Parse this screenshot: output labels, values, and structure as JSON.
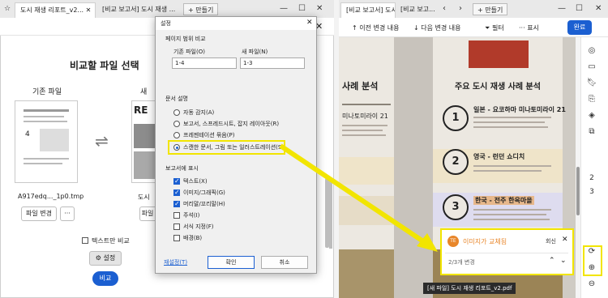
{
  "left_window": {
    "tabs": [
      "도시 재생 리포트_v2...",
      "[비교 보고서] 도시 재생 ..."
    ],
    "new_tab_label": "만들기",
    "heading": "비교할 파일 선택",
    "original_label": "기존 파일",
    "original_filename": "A917edq..._1p0.tmp",
    "change_file_label": "파일 변경",
    "more_label": "···",
    "new_label_partial": "새",
    "new_filename_partial": "도시",
    "new_change_partial": "파일",
    "text_only_label": "텍스트만 비교",
    "settings_label": "설정",
    "compare_label": "비교"
  },
  "dialog": {
    "title": "설정",
    "page_range_title": "페이지 범위 비교",
    "original_file_label": "기존 파일(O)",
    "original_range": "1-4",
    "new_file_label": "새 파일(N)",
    "new_range": "1-3",
    "doc_desc_title": "문서 설명",
    "radios": [
      {
        "label": "자동 감지(A)",
        "selected": false
      },
      {
        "label": "보고서, 스프레드시트, 잡지 레이아웃(R)",
        "selected": false
      },
      {
        "label": "프레젠테이션 묶음(P)",
        "selected": false
      },
      {
        "label": "스캔한 문서, 그림 또는 일러스트레이션(S)",
        "selected": true
      }
    ],
    "show_title": "보고서에 표시",
    "checks": [
      {
        "label": "텍스트(X)",
        "checked": true
      },
      {
        "label": "이미지/그래픽(G)",
        "checked": true
      },
      {
        "label": "머리말/꼬리말(H)",
        "checked": true
      },
      {
        "label": "주석(I)",
        "checked": false
      },
      {
        "label": "서식 지정(F)",
        "checked": false
      },
      {
        "label": "배경(B)",
        "checked": false
      }
    ],
    "reset_label": "재설정(T)",
    "ok_label": "확인",
    "cancel_label": "취소"
  },
  "right_window": {
    "tabs": [
      "[비교 보고서] 도시 재...",
      "[비교 보고..."
    ],
    "new_tab_label": "만들기",
    "prev_change": "이전 변경 내용",
    "next_change": "다음 변경 내용",
    "filter_label": "필터",
    "show_label": "표시",
    "done_label": "완료",
    "page_left_title": "사례 분석",
    "left_item": "미나토미라이 21",
    "page_right_title": "주요 도시 재생 사례 분석",
    "items": [
      {
        "num": "1",
        "title": "일본 - 요코하마 미나토미라이 21"
      },
      {
        "num": "2",
        "title": "영국 - 런던 쇼디치"
      },
      {
        "num": "3",
        "title": "한국 - 전주 한옥마을"
      }
    ],
    "footer_file": "[새 파일] 도시 재생 리포트_v2.pdf",
    "colors": {
      "highlight_yellow": "#f2e500",
      "accent_orange": "#e8862a",
      "blue": "#1b5fd1"
    }
  },
  "notification": {
    "title": "이미지가 교체됨",
    "action": "회신",
    "count_text": "2/3개 변경",
    "icon_text": "TE"
  }
}
